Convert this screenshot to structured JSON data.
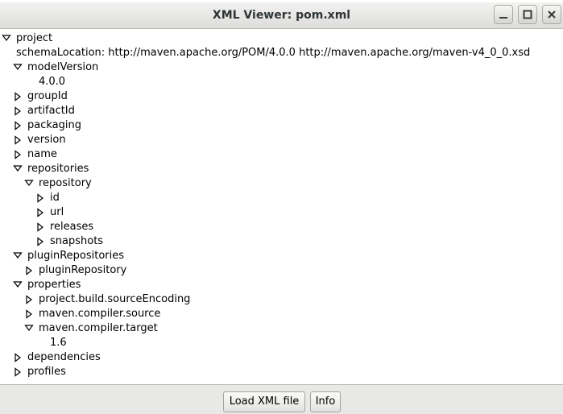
{
  "window": {
    "title": "XML Viewer: pom.xml"
  },
  "tree": {
    "rows": [
      {
        "label": "project",
        "toggle": "expanded"
      },
      {
        "label": "schemaLocation: http://maven.apache.org/POM/4.0.0 http://maven.apache.org/maven-v4_0_0.xsd",
        "toggle": "none"
      },
      {
        "label": "modelVersion",
        "toggle": "expanded"
      },
      {
        "label": "4.0.0",
        "toggle": "none"
      },
      {
        "label": "groupId",
        "toggle": "collapsed"
      },
      {
        "label": "artifactId",
        "toggle": "collapsed"
      },
      {
        "label": "packaging",
        "toggle": "collapsed"
      },
      {
        "label": "version",
        "toggle": "collapsed"
      },
      {
        "label": "name",
        "toggle": "collapsed"
      },
      {
        "label": "repositories",
        "toggle": "expanded"
      },
      {
        "label": "repository",
        "toggle": "expanded"
      },
      {
        "label": "id",
        "toggle": "collapsed"
      },
      {
        "label": "url",
        "toggle": "collapsed"
      },
      {
        "label": "releases",
        "toggle": "collapsed"
      },
      {
        "label": "snapshots",
        "toggle": "collapsed"
      },
      {
        "label": "pluginRepositories",
        "toggle": "expanded"
      },
      {
        "label": "pluginRepository",
        "toggle": "collapsed"
      },
      {
        "label": "properties",
        "toggle": "expanded"
      },
      {
        "label": "project.build.sourceEncoding",
        "toggle": "collapsed"
      },
      {
        "label": "maven.compiler.source",
        "toggle": "collapsed"
      },
      {
        "label": "maven.compiler.target",
        "toggle": "expanded"
      },
      {
        "label": "1.6",
        "toggle": "none"
      },
      {
        "label": "dependencies",
        "toggle": "collapsed"
      },
      {
        "label": "profiles",
        "toggle": "collapsed"
      }
    ]
  },
  "buttons": {
    "load": "Load XML file",
    "info": "Info"
  },
  "icons": {
    "minimize": "minimize-icon",
    "maximize": "maximize-icon",
    "close": "close-icon",
    "expanded": "triangle-down-icon",
    "collapsed": "triangle-right-icon"
  }
}
